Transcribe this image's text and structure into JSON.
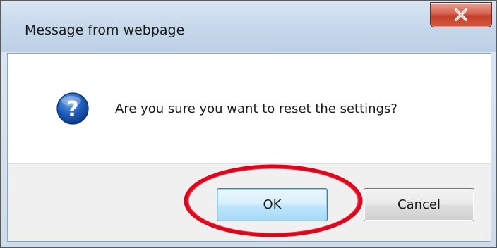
{
  "window": {
    "title": "Message from webpage",
    "close_icon": "close-x-icon"
  },
  "message": {
    "icon": "question-icon",
    "text": "Are you sure you want to reset the settings?"
  },
  "buttons": {
    "ok_label": "OK",
    "cancel_label": "Cancel"
  },
  "annotation": {
    "type": "highlight-ellipse",
    "target": "ok-button",
    "color": "#e3001b"
  },
  "colors": {
    "close_button": "#c5402b",
    "ok_button": "#bee6fd",
    "titlebar": "#c6d7ea"
  }
}
